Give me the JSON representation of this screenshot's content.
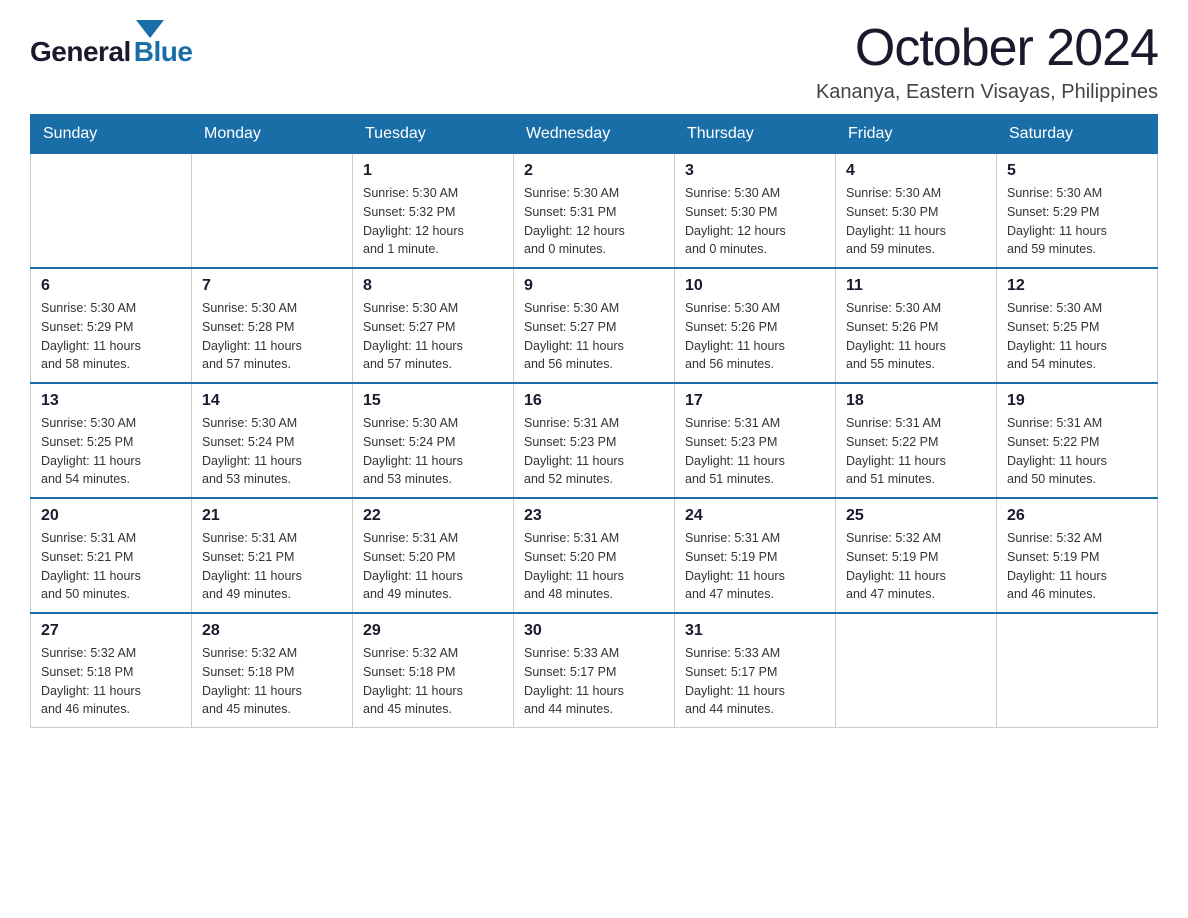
{
  "logo": {
    "general": "General",
    "blue": "Blue"
  },
  "header": {
    "month": "October 2024",
    "location": "Kananya, Eastern Visayas, Philippines"
  },
  "weekdays": [
    "Sunday",
    "Monday",
    "Tuesday",
    "Wednesday",
    "Thursday",
    "Friday",
    "Saturday"
  ],
  "weeks": [
    [
      {
        "day": "",
        "info": ""
      },
      {
        "day": "",
        "info": ""
      },
      {
        "day": "1",
        "info": "Sunrise: 5:30 AM\nSunset: 5:32 PM\nDaylight: 12 hours\nand 1 minute."
      },
      {
        "day": "2",
        "info": "Sunrise: 5:30 AM\nSunset: 5:31 PM\nDaylight: 12 hours\nand 0 minutes."
      },
      {
        "day": "3",
        "info": "Sunrise: 5:30 AM\nSunset: 5:30 PM\nDaylight: 12 hours\nand 0 minutes."
      },
      {
        "day": "4",
        "info": "Sunrise: 5:30 AM\nSunset: 5:30 PM\nDaylight: 11 hours\nand 59 minutes."
      },
      {
        "day": "5",
        "info": "Sunrise: 5:30 AM\nSunset: 5:29 PM\nDaylight: 11 hours\nand 59 minutes."
      }
    ],
    [
      {
        "day": "6",
        "info": "Sunrise: 5:30 AM\nSunset: 5:29 PM\nDaylight: 11 hours\nand 58 minutes."
      },
      {
        "day": "7",
        "info": "Sunrise: 5:30 AM\nSunset: 5:28 PM\nDaylight: 11 hours\nand 57 minutes."
      },
      {
        "day": "8",
        "info": "Sunrise: 5:30 AM\nSunset: 5:27 PM\nDaylight: 11 hours\nand 57 minutes."
      },
      {
        "day": "9",
        "info": "Sunrise: 5:30 AM\nSunset: 5:27 PM\nDaylight: 11 hours\nand 56 minutes."
      },
      {
        "day": "10",
        "info": "Sunrise: 5:30 AM\nSunset: 5:26 PM\nDaylight: 11 hours\nand 56 minutes."
      },
      {
        "day": "11",
        "info": "Sunrise: 5:30 AM\nSunset: 5:26 PM\nDaylight: 11 hours\nand 55 minutes."
      },
      {
        "day": "12",
        "info": "Sunrise: 5:30 AM\nSunset: 5:25 PM\nDaylight: 11 hours\nand 54 minutes."
      }
    ],
    [
      {
        "day": "13",
        "info": "Sunrise: 5:30 AM\nSunset: 5:25 PM\nDaylight: 11 hours\nand 54 minutes."
      },
      {
        "day": "14",
        "info": "Sunrise: 5:30 AM\nSunset: 5:24 PM\nDaylight: 11 hours\nand 53 minutes."
      },
      {
        "day": "15",
        "info": "Sunrise: 5:30 AM\nSunset: 5:24 PM\nDaylight: 11 hours\nand 53 minutes."
      },
      {
        "day": "16",
        "info": "Sunrise: 5:31 AM\nSunset: 5:23 PM\nDaylight: 11 hours\nand 52 minutes."
      },
      {
        "day": "17",
        "info": "Sunrise: 5:31 AM\nSunset: 5:23 PM\nDaylight: 11 hours\nand 51 minutes."
      },
      {
        "day": "18",
        "info": "Sunrise: 5:31 AM\nSunset: 5:22 PM\nDaylight: 11 hours\nand 51 minutes."
      },
      {
        "day": "19",
        "info": "Sunrise: 5:31 AM\nSunset: 5:22 PM\nDaylight: 11 hours\nand 50 minutes."
      }
    ],
    [
      {
        "day": "20",
        "info": "Sunrise: 5:31 AM\nSunset: 5:21 PM\nDaylight: 11 hours\nand 50 minutes."
      },
      {
        "day": "21",
        "info": "Sunrise: 5:31 AM\nSunset: 5:21 PM\nDaylight: 11 hours\nand 49 minutes."
      },
      {
        "day": "22",
        "info": "Sunrise: 5:31 AM\nSunset: 5:20 PM\nDaylight: 11 hours\nand 49 minutes."
      },
      {
        "day": "23",
        "info": "Sunrise: 5:31 AM\nSunset: 5:20 PM\nDaylight: 11 hours\nand 48 minutes."
      },
      {
        "day": "24",
        "info": "Sunrise: 5:31 AM\nSunset: 5:19 PM\nDaylight: 11 hours\nand 47 minutes."
      },
      {
        "day": "25",
        "info": "Sunrise: 5:32 AM\nSunset: 5:19 PM\nDaylight: 11 hours\nand 47 minutes."
      },
      {
        "day": "26",
        "info": "Sunrise: 5:32 AM\nSunset: 5:19 PM\nDaylight: 11 hours\nand 46 minutes."
      }
    ],
    [
      {
        "day": "27",
        "info": "Sunrise: 5:32 AM\nSunset: 5:18 PM\nDaylight: 11 hours\nand 46 minutes."
      },
      {
        "day": "28",
        "info": "Sunrise: 5:32 AM\nSunset: 5:18 PM\nDaylight: 11 hours\nand 45 minutes."
      },
      {
        "day": "29",
        "info": "Sunrise: 5:32 AM\nSunset: 5:18 PM\nDaylight: 11 hours\nand 45 minutes."
      },
      {
        "day": "30",
        "info": "Sunrise: 5:33 AM\nSunset: 5:17 PM\nDaylight: 11 hours\nand 44 minutes."
      },
      {
        "day": "31",
        "info": "Sunrise: 5:33 AM\nSunset: 5:17 PM\nDaylight: 11 hours\nand 44 minutes."
      },
      {
        "day": "",
        "info": ""
      },
      {
        "day": "",
        "info": ""
      }
    ]
  ]
}
